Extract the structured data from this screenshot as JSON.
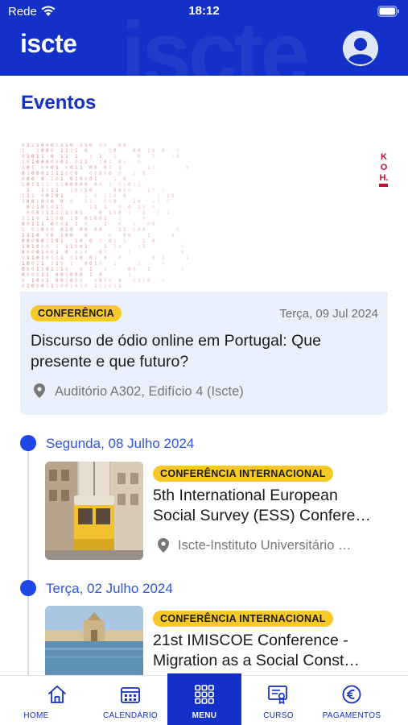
{
  "status_bar": {
    "carrier": "Rede",
    "time": "18:12"
  },
  "header": {
    "logo": "iscte",
    "watermark": "iscte"
  },
  "page": {
    "title": "Eventos"
  },
  "featured": {
    "category": "CONFERÊNCIA",
    "date": "Terça, 09 Jul 2024",
    "title": "Discurso de ódio online em Portugal: Que presente e que futuro?",
    "location": "Auditório A302, Edifício 4 (Iscte)",
    "logo_text": "KOH"
  },
  "timeline": [
    {
      "date": "Segunda, 08 Julho 2024",
      "category": "CONFERÊNCIA INTERNACIONAL",
      "title_line1": "5th International European",
      "title_line2": "Social Survey (ESS) Confere…",
      "location": "Iscte-Instituto Universitário …"
    },
    {
      "date": "Terça, 02 Julho 2024",
      "category": "CONFERÊNCIA INTERNACIONAL",
      "title_line1": "21st IMISCOE Conference -",
      "title_line2": "Migration as a Social Const…",
      "location": ""
    }
  ],
  "nav": {
    "items": [
      {
        "label": "HOME",
        "icon": "home-icon"
      },
      {
        "label": "CALENDÁRIO",
        "icon": "calendar-icon"
      },
      {
        "label": "MENU",
        "icon": "grid-icon"
      },
      {
        "label": "CURSO",
        "icon": "certificate-icon"
      },
      {
        "label": "PAGAMENTOS",
        "icon": "euro-icon"
      }
    ],
    "active": "MENU"
  },
  "colors": {
    "brand": "#1330c8",
    "accent_dot": "#1f47e8",
    "badge": "#f7c927",
    "card_bg": "#e9effb"
  }
}
